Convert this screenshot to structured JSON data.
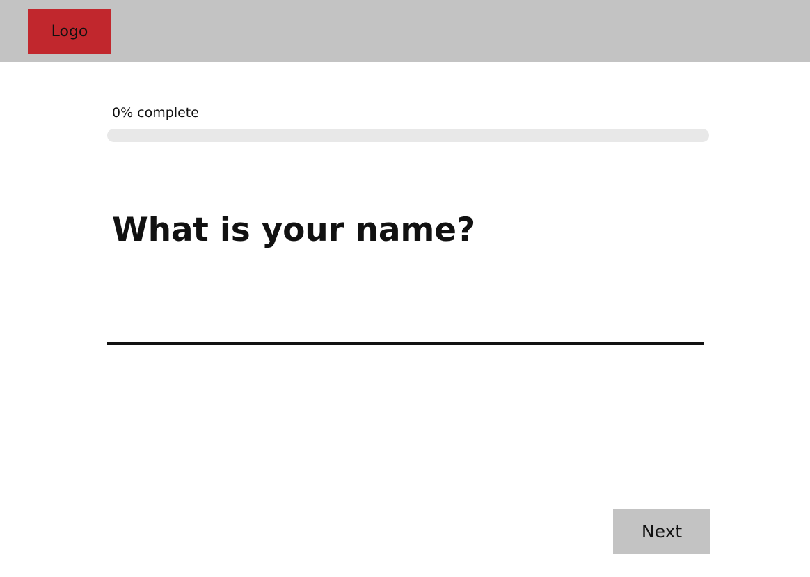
{
  "header": {
    "logo_label": "Logo",
    "background_color": "#c3c3c3",
    "logo_color": "#c1272d"
  },
  "progress": {
    "label": "0% complete",
    "percent": 0
  },
  "question": {
    "title": "What is your name?"
  },
  "name_input": {
    "value": "",
    "placeholder": ""
  },
  "footer": {
    "next_label": "Next"
  }
}
